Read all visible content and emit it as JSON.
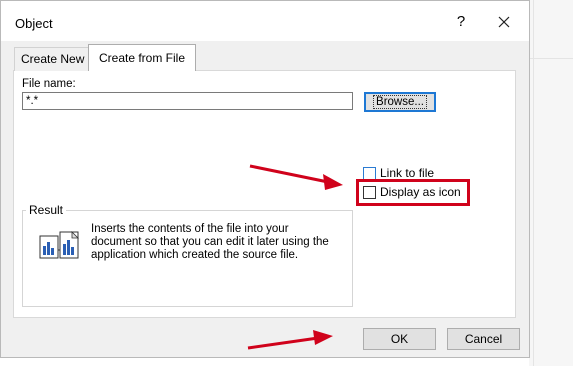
{
  "window": {
    "title": "Object",
    "help_glyph": "?",
    "close_icon": "close-icon"
  },
  "tabs": [
    {
      "label": "Create New",
      "active": false
    },
    {
      "label": "Create from File",
      "active": true
    }
  ],
  "file": {
    "label": "File name:",
    "value": "*.*",
    "browse_label": "Browse..."
  },
  "options": {
    "link_label": "Link to file",
    "link_checked": false,
    "display_label": "Display as icon",
    "display_checked": false
  },
  "result": {
    "title": "Result",
    "text": "Inserts the contents of the file into your document so that you can edit it later using the application which created the source file.",
    "icon": "embedded-document-icon"
  },
  "buttons": {
    "ok": "OK",
    "cancel": "Cancel"
  },
  "annotations": {
    "color": "#d0021b",
    "highlight": "display-as-icon",
    "arrows": [
      "arrow-to-display-as-icon",
      "arrow-to-ok"
    ]
  }
}
